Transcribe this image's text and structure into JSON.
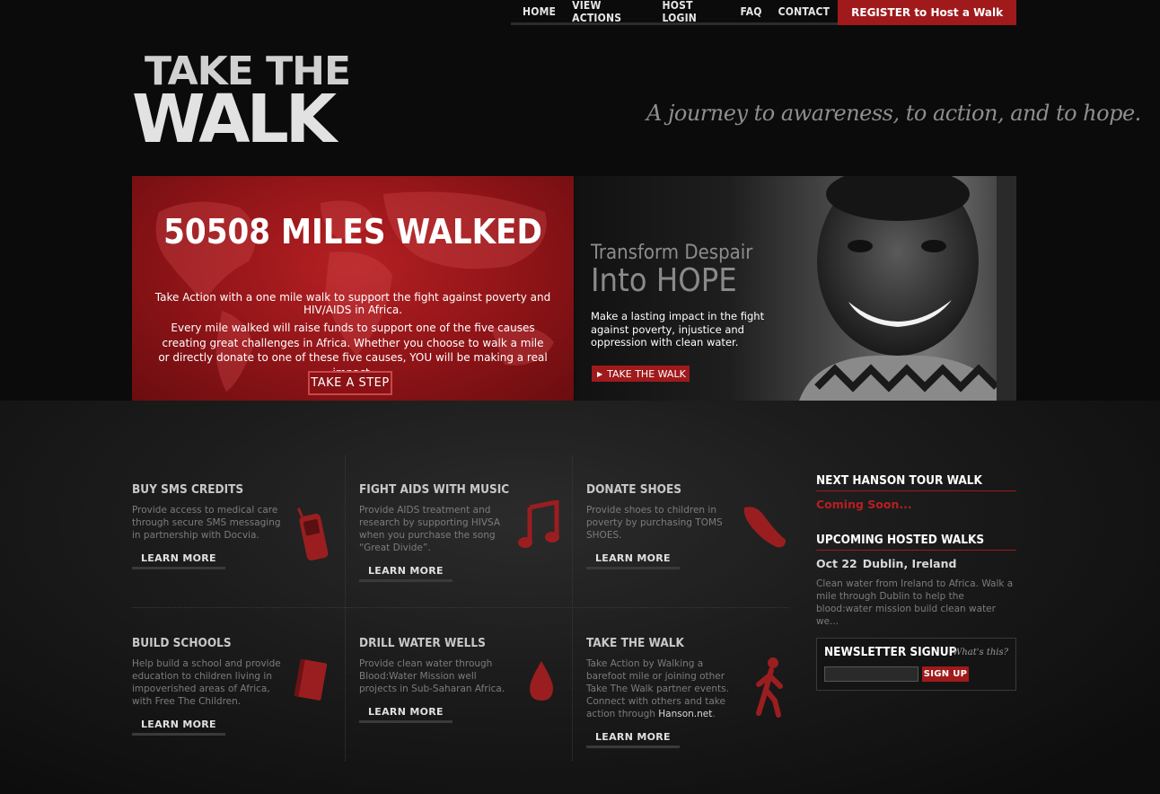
{
  "nav": {
    "links": [
      "HOME",
      "VIEW ACTIONS",
      "HOST LOGIN",
      "FAQ",
      "CONTACT"
    ],
    "register": "REGISTER to Host a Walk"
  },
  "logo": {
    "line1": "TAKE THE",
    "line2": "WALK"
  },
  "tagline": "A journey to awareness, to action, and to hope.",
  "hero_left": {
    "miles": "50508 MILES WALKED",
    "intro": "Take Action with a one mile walk to support the fight against poverty and HIV/AIDS in Africa.",
    "line1": "Every mile walked will raise funds to support one of the five causes",
    "line2": "creating great challenges in Africa. Whether you choose to walk a mile",
    "line3": "or directly donate to one of these five causes, YOU will be making a real impact.",
    "button": "TAKE A STEP"
  },
  "hero_right": {
    "subtitle": "Transform Despair",
    "title": "Into HOPE",
    "text": "Make a lasting impact in the fight against poverty, injustice and oppression with clean water.",
    "button": "TAKE THE WALK",
    "button_icon": "play-triangle-icon"
  },
  "causes": [
    {
      "title": "BUY SMS CREDITS",
      "text": "Provide access to medical care through secure SMS messaging in partnership with Docvia.",
      "link": "LEARN MORE",
      "icon": "cell-phone-icon"
    },
    {
      "title": "FIGHT AIDS WITH MUSIC",
      "text": "Provide AIDS treatment and research by supporting HIVSA when you purchase the song “Great Divide”.",
      "link": "LEARN MORE",
      "icon": "music-note-icon"
    },
    {
      "title": "DONATE SHOES",
      "text": "Provide shoes to children in poverty by purchasing TOMS SHOES.",
      "link": "LEARN MORE",
      "icon": "shoe-icon"
    },
    {
      "title": "BUILD SCHOOLS",
      "text": "Help build a school and provide education to children living in impoverished areas of Africa, with Free The Children.",
      "link": "LEARN MORE",
      "icon": "book-icon"
    },
    {
      "title": "DRILL WATER WELLS",
      "text": "Provide clean water through Blood:Water Mission well projects in Sub-Saharan Africa.",
      "link": "LEARN MORE",
      "icon": "water-drop-icon"
    },
    {
      "title": "TAKE THE WALK",
      "text": "Take Action by Walking a barefoot mile or joining other Take The Walk partner events. Connect with others and take action through",
      "text_link": "Hanson.net",
      "text_end": ".",
      "link": "LEARN MORE",
      "icon": "walking-person-icon"
    }
  ],
  "sidebar": {
    "next_title": "NEXT HANSON TOUR WALK",
    "next_status": "Coming Soon...",
    "hosted_title": "UPCOMING HOSTED WALKS",
    "event_date": "Oct 22",
    "event_place": "Dublin, Ireland",
    "event_desc": "Clean water from Ireland to Africa. Walk a mile through Dublin to help the blood:water mission build clean water we...",
    "newsletter_title": "NEWSLETTER SIGNUP",
    "newsletter_help": "What's this?",
    "signup_button": "SIGN UP"
  },
  "colors": {
    "accent": "#a01a1c",
    "background": "#0b0b0b"
  }
}
